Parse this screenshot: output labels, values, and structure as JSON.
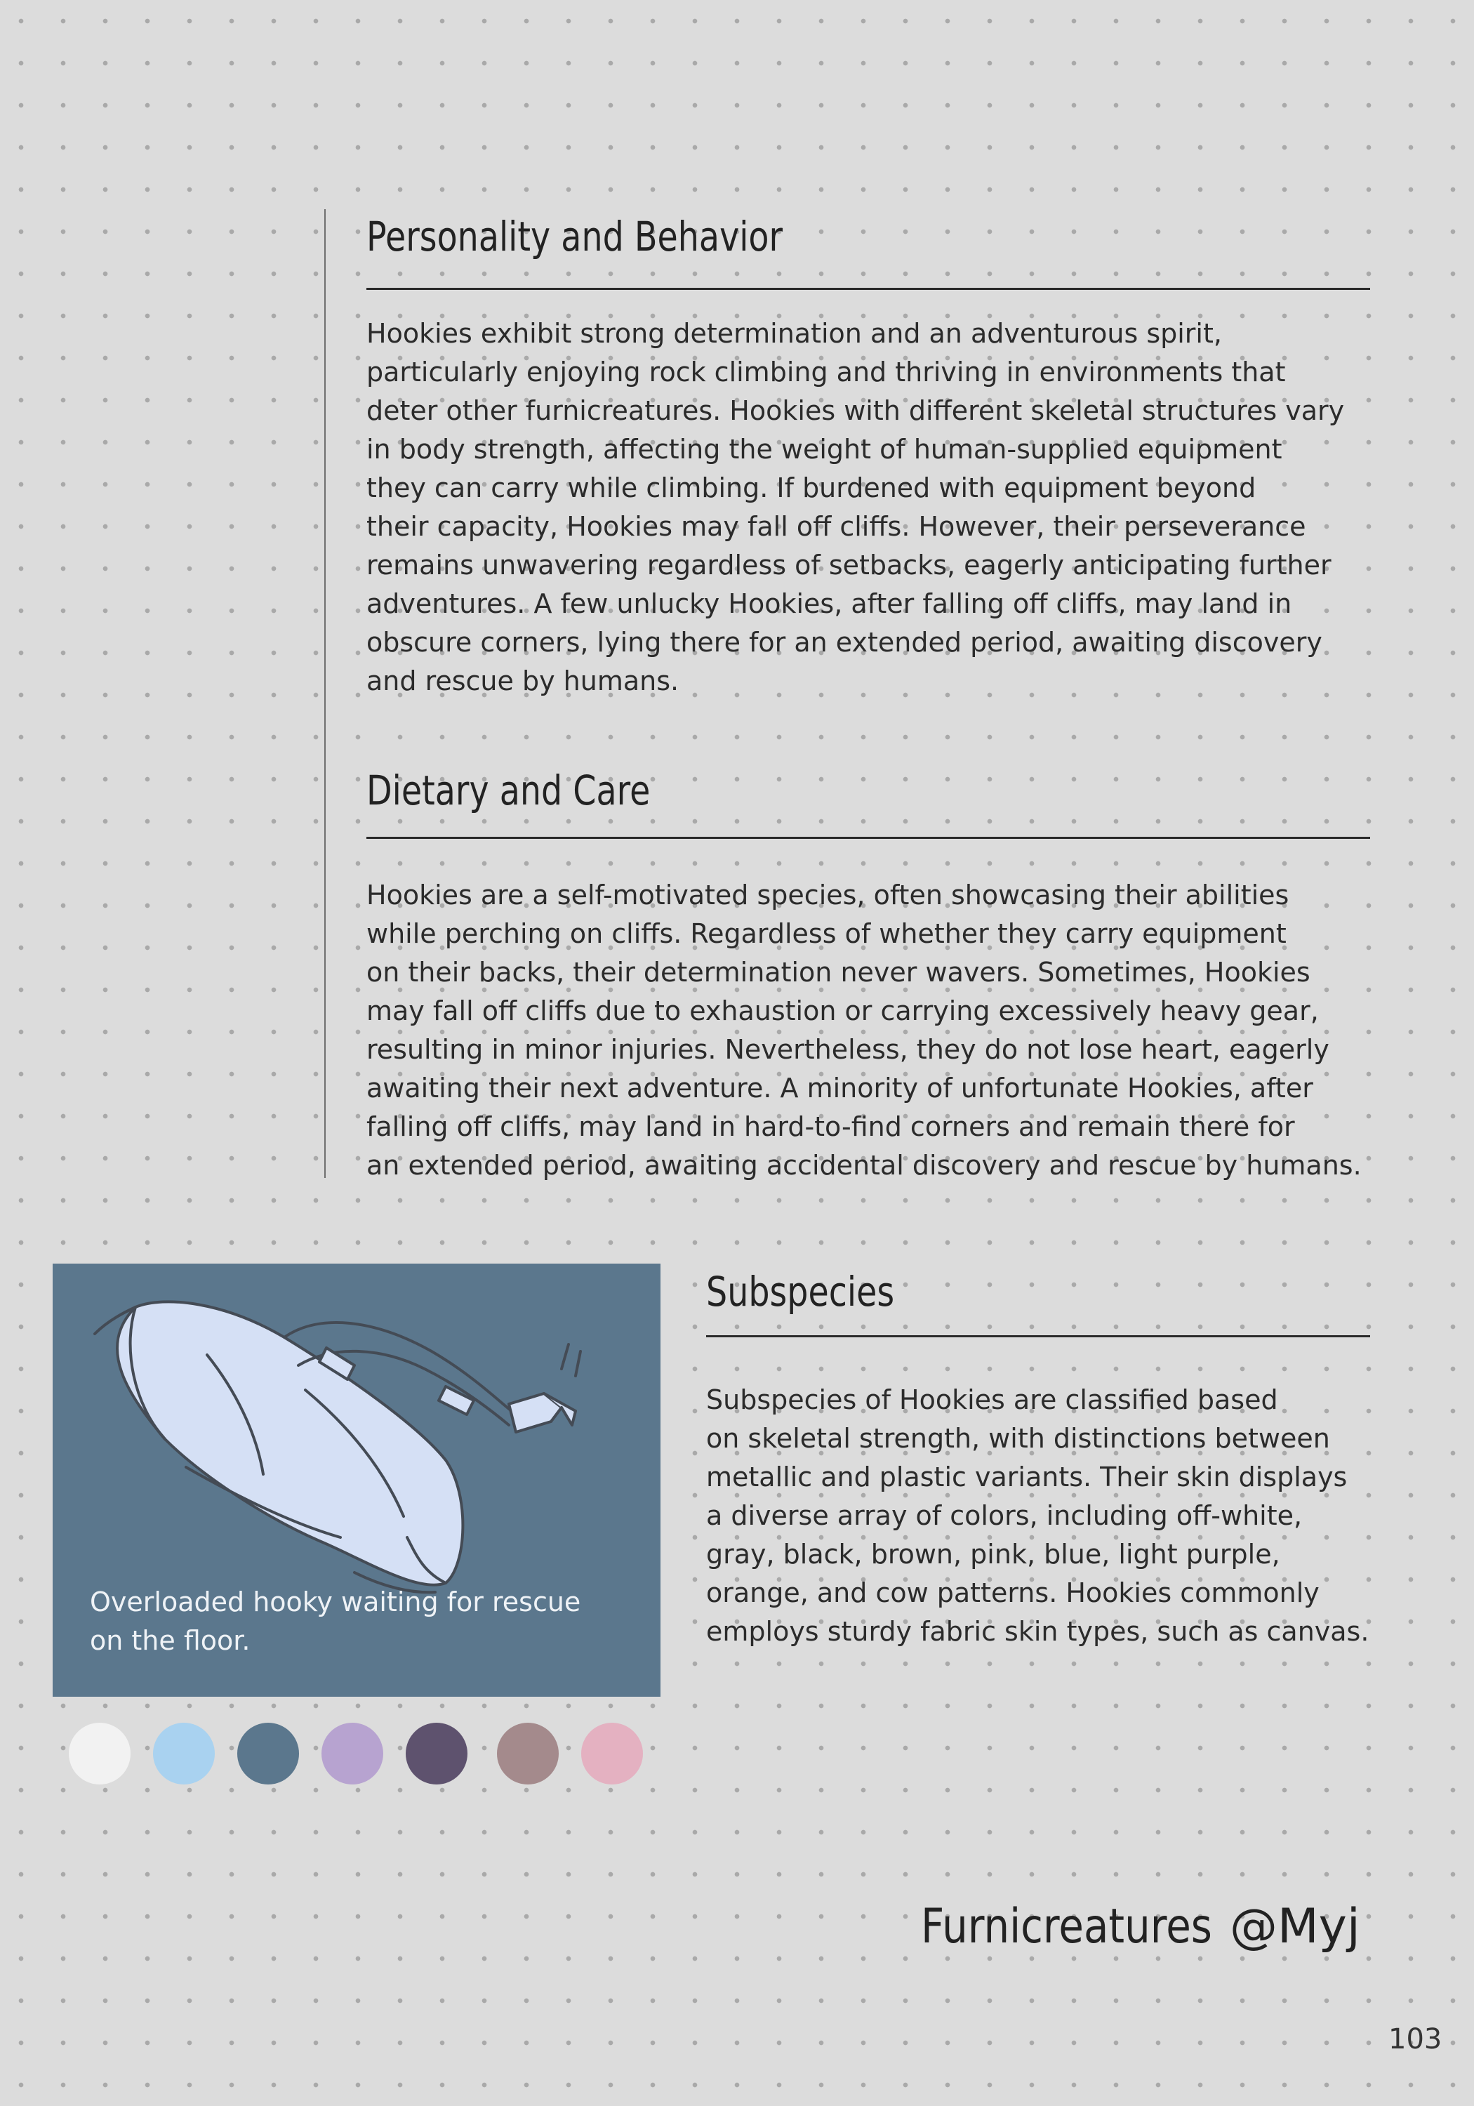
{
  "sections": [
    {
      "heading": "Personality and Behavior",
      "lines": [
        "Hookies exhibit strong determination and an adventurous spirit,",
        "particularly enjoying rock climbing and thriving in environments that",
        "deter other furnicreatures. Hookies with different skeletal structures vary",
        "in body strength, affecting the weight of human-supplied equipment",
        "they can carry while climbing. If burdened with equipment beyond",
        "their capacity, Hookies may fall off cliffs. However, their perseverance",
        "remains unwavering regardless of setbacks, eagerly anticipating further",
        "adventures. A few unlucky Hookies, after falling off cliffs, may land in",
        "obscure corners, lying there for an extended period, awaiting discovery",
        "and rescue by humans."
      ]
    },
    {
      "heading": "Dietary and Care",
      "lines": [
        "Hookies are a self-motivated species, often showcasing their abilities",
        "while perching on cliffs. Regardless of whether they carry equipment",
        "on their backs, their determination never wavers. Sometimes, Hookies",
        "may fall off cliffs due to exhaustion or carrying excessively heavy gear,",
        "resulting in minor injuries. Nevertheless, they do not lose heart, eagerly",
        "awaiting their next adventure. A minority of unfortunate Hookies, after",
        "falling off cliffs, may land in hard-to-find corners and remain there for",
        "an extended period, awaiting accidental discovery and rescue by humans."
      ]
    },
    {
      "heading": "Subspecies",
      "lines": [
        "Subspecies of Hookies are classified based",
        "on skeletal strength, with distinctions between",
        "metallic and plastic variants. Their skin displays",
        "a diverse array of colors, including off-white,",
        "gray, black, brown, pink, blue, light purple,",
        "orange, and cow patterns. Hookies commonly",
        "employs sturdy fabric skin types, such as canvas."
      ]
    }
  ],
  "figure": {
    "caption_lines": [
      "Overloaded hooky waiting for rescue",
      "on the floor."
    ],
    "background": "#5b778d",
    "illustration": "hooky-bag-illustration"
  },
  "swatches": [
    "#f2f2f2",
    "#a9d2f0",
    "#5b778d",
    "#b7a3d0",
    "#5e526e",
    "#a48a8c",
    "#e4b1c1"
  ],
  "footer": {
    "brand": "Furnicreatures",
    "handle": "@Myj",
    "page_number": "103"
  }
}
